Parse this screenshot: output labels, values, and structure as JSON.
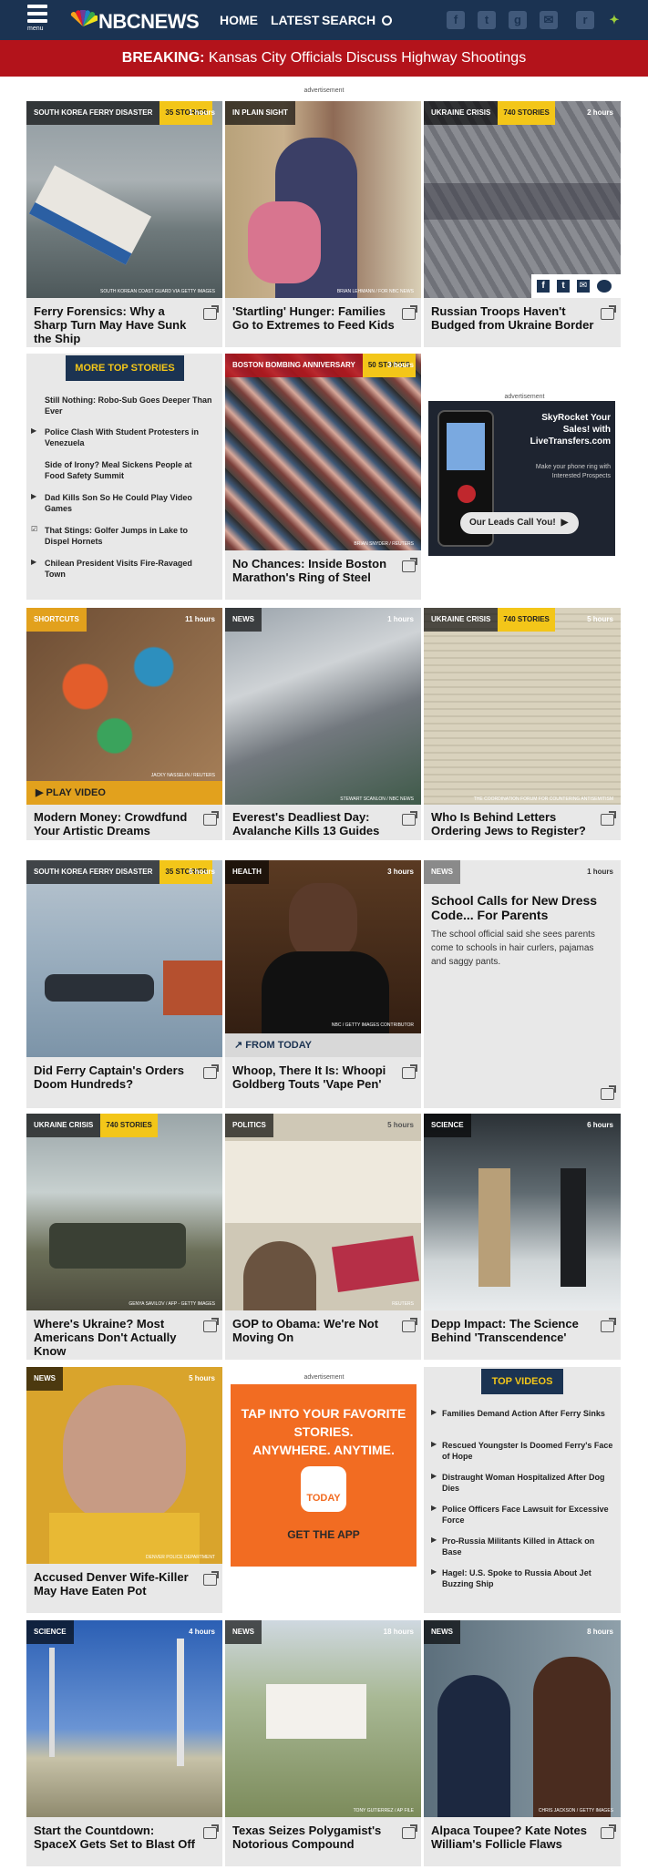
{
  "header": {
    "menu_label": "menu",
    "brand": "NBCNEWS",
    "nav": [
      "HOME",
      "LATEST",
      "SEARCH"
    ],
    "colors": {
      "bar": "#1b3352",
      "breaking": "#b3131b",
      "accent": "#f3c619"
    }
  },
  "breaking": {
    "label": "BREAKING:",
    "text": " Kansas City Officials Discuss Highway Shootings"
  },
  "ad_label": "advertisement",
  "cards": [
    {
      "section": "SOUTH KOREA FERRY DISASTER",
      "count": "35 STORIES",
      "age": "1 hours",
      "credit": "SOUTH KOREAN COAST GUARD VIA GETTY IMAGES",
      "caption": "Ferry Forensics: Why a Sharp Turn May Have Sunk the Ship"
    },
    {
      "section": "IN PLAIN SIGHT",
      "count": "",
      "age": "",
      "credit": "BRIAN LEHMANN / FOR NBC NEWS",
      "caption": "'Startling' Hunger: Families Go to Extremes to Feed Kids"
    },
    {
      "section": "UKRAINE CRISIS",
      "count": "740 STORIES",
      "age": "2 hours",
      "credit": "",
      "caption": "Russian Troops Haven't Budged from Ukraine Border"
    },
    {
      "section": "BOSTON BOMBING ANNIVERSARY",
      "count": "50 STORIES",
      "age": "3 hours",
      "credit": "BRIAN SNYDER / REUTERS",
      "caption": "No Chances: Inside Boston Marathon's Ring of Steel"
    },
    {
      "section": "SHORTCUTS",
      "count": "",
      "age": "11 hours",
      "credit": "JACKY NASSELIN / REUTERS",
      "caption": "Modern Money: Crowdfund Your Artistic Dreams",
      "bar": "PLAY VIDEO"
    },
    {
      "section": "NEWS",
      "count": "",
      "age": "1 hours",
      "credit": "STEWART SCANLON / NBC NEWS",
      "caption": "Everest's Deadliest Day: Avalanche Kills 13 Guides"
    },
    {
      "section": "UKRAINE CRISIS",
      "count": "740 STORIES",
      "age": "5 hours",
      "credit": "THE COORDINATION FORUM FOR COUNTERING ANTISEMITISM",
      "caption": "Who Is Behind Letters Ordering Jews to Register?"
    },
    {
      "section": "SOUTH KOREA FERRY DISASTER",
      "count": "35 STORIES",
      "age": "6 hours",
      "credit": "",
      "caption": "Did Ferry Captain's Orders Doom Hundreds?"
    },
    {
      "section": "HEALTH",
      "count": "",
      "age": "3 hours",
      "credit": "NBC / GETTY IMAGES CONTRIBUTOR",
      "caption": "Whoop, There It Is: Whoopi Goldberg Touts 'Vape Pen'",
      "bar": "FROM TODAY"
    },
    {
      "section": "NEWS",
      "count": "",
      "age": "1 hours",
      "credit": "",
      "caption": "School Calls for New Dress Code... For Parents",
      "body": "The school official said she sees parents come to schools in hair curlers, pajamas and saggy pants."
    },
    {
      "section": "UKRAINE CRISIS",
      "count": "740 STORIES",
      "age": "",
      "credit": "GENYA SAVILOV / AFP - GETTY IMAGES",
      "caption": "Where's Ukraine? Most Americans Don't Actually Know"
    },
    {
      "section": "POLITICS",
      "count": "",
      "age": "5 hours",
      "credit": "REUTERS",
      "caption": "GOP to Obama: We're Not Moving On"
    },
    {
      "section": "SCIENCE",
      "count": "",
      "age": "6 hours",
      "credit": "",
      "caption": "Depp Impact: The Science Behind 'Transcendence'"
    },
    {
      "section": "NEWS",
      "count": "",
      "age": "5 hours",
      "credit": "DENVER POLICE DEPARTMENT",
      "caption": "Accused Denver Wife-Killer May Have Eaten Pot"
    },
    {
      "section": "SCIENCE",
      "count": "",
      "age": "4 hours",
      "credit": "",
      "caption": "Start the Countdown: SpaceX Gets Set to Blast Off"
    },
    {
      "section": "NEWS",
      "count": "",
      "age": "18 hours",
      "credit": "TONY GUTIERREZ / AP FILE",
      "caption": "Texas Seizes Polygamist's Notorious Compound"
    },
    {
      "section": "NEWS",
      "count": "",
      "age": "8 hours",
      "credit": "CHRIS JACKSON / GETTY IMAGES",
      "caption": "Alpaca Toupee? Kate Notes William's Follicle Flaws"
    }
  ],
  "more_top_stories": {
    "title": "MORE TOP STORIES",
    "items": [
      {
        "text": "Still Nothing: Robo-Sub Goes Deeper Than Ever",
        "icon": ""
      },
      {
        "text": "Police Clash With Student Protesters in Venezuela",
        "icon": "play-icon"
      },
      {
        "text": "Side of Irony? Meal Sickens People at Food Safety Summit",
        "icon": ""
      },
      {
        "text": "Dad Kills Son So He Could Play Video Games",
        "icon": "play-icon"
      },
      {
        "text": "That Stings: Golfer Jumps in Lake to Dispel Hornets",
        "icon": "check-icon"
      },
      {
        "text": "Chilean President Visits Fire-Ravaged Town",
        "icon": "play-icon"
      }
    ]
  },
  "top_videos": {
    "title": "TOP VIDEOS",
    "items": [
      "Families Demand Action After Ferry Sinks",
      "Rescued Youngster Is Doomed Ferry's Face of Hope",
      "Distraught Woman Hospitalized After Dog Dies",
      "Police Officers Face Lawsuit for Excessive Force",
      "Pro-Russia Militants Killed in Attack on Base",
      "Hagel: U.S. Spoke to Russia About Jet Buzzing Ship"
    ]
  },
  "ad1": {
    "line1": "SkyRocket Your",
    "line2": "Sales! with",
    "line3": "LiveTransfers.com",
    "line4": "Make your phone ring with",
    "line5": "Interested Prospects",
    "cta": "Our Leads Call You!"
  },
  "ad2": {
    "line1": "TAP INTO YOUR FAVORITE",
    "line2": "STORIES.",
    "line3": "ANYWHERE. ANYTIME.",
    "logo": "TODAY",
    "cta": "GET THE APP"
  }
}
